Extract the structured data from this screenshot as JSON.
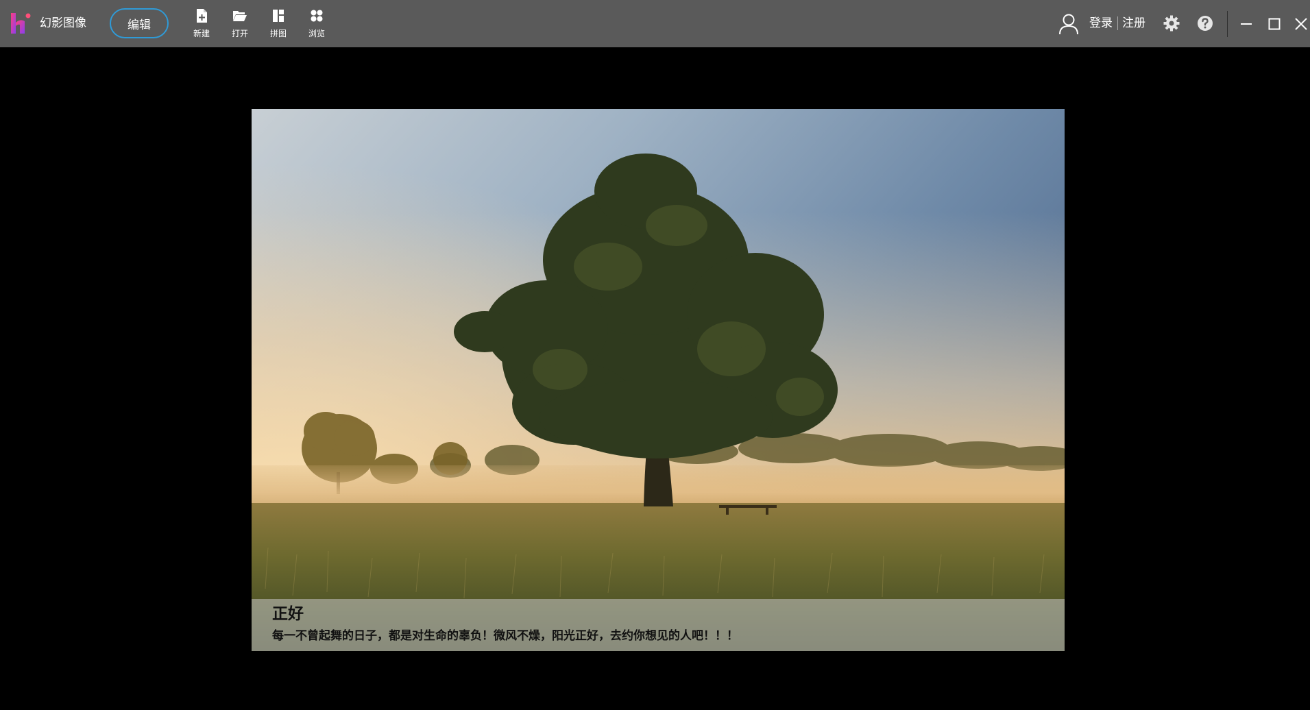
{
  "app": {
    "title": "幻影图像",
    "edit_label": "编辑"
  },
  "toolbar": {
    "items": [
      {
        "label": "新建",
        "icon": "new-file-icon"
      },
      {
        "label": "打开",
        "icon": "open-folder-icon"
      },
      {
        "label": "拼图",
        "icon": "collage-icon"
      },
      {
        "label": "浏览",
        "icon": "browse-grid-icon"
      }
    ]
  },
  "account": {
    "login_label": "登录",
    "register_label": "注册"
  },
  "window_controls": [
    "settings-icon",
    "help-icon",
    "minimize-icon",
    "maximize-icon",
    "close-icon"
  ],
  "viewer": {
    "image_subject": "lone tree in misty meadow at sunrise",
    "caption_title": "正好",
    "caption_text": "每一不曾起舞的日子，都是对生命的辜负！微风不燥，阳光正好，去约你想见的人吧！！！"
  },
  "colors": {
    "titlebar_bg": "#5a5a5a",
    "accent": "#2f9bd8",
    "logo_pink": "#e8358f",
    "logo_purple": "#9b3fe0",
    "background": "#000000"
  }
}
